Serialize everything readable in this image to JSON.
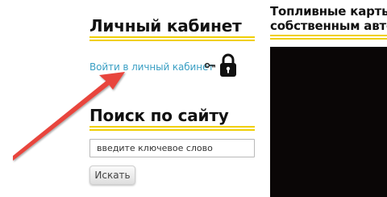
{
  "login_widget": {
    "title": "Личный кабинет",
    "link_label": "Войти в личный кабинет"
  },
  "search_widget": {
    "title": "Поиск по сайту",
    "input_value": "введите ключевое слово",
    "button_label": "Искать"
  },
  "right_column": {
    "title_line1": "Топливные карты",
    "title_line2": "собственным авто"
  },
  "icons": [
    "key-icon",
    "lock-icon"
  ],
  "colors": {
    "accent_line": "#f0cf06",
    "link": "#3a9fc4",
    "annotation_arrow": "#e8453c",
    "media_background": "#0a0606"
  }
}
